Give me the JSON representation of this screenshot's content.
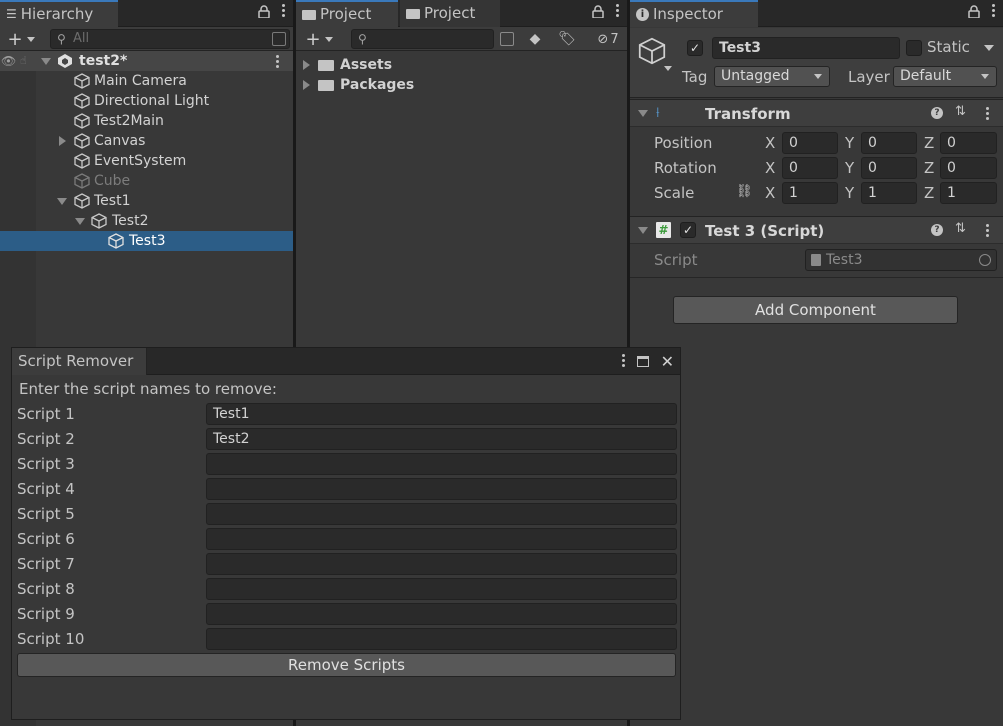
{
  "hierarchy": {
    "tab_label": "Hierarchy",
    "search_placeholder": "All",
    "items": [
      {
        "label": "test2*"
      },
      {
        "label": "Main Camera"
      },
      {
        "label": "Directional Light"
      },
      {
        "label": "Test2Main"
      },
      {
        "label": "Canvas"
      },
      {
        "label": "EventSystem"
      },
      {
        "label": "Cube"
      },
      {
        "label": "Test1"
      },
      {
        "label": "Test2"
      },
      {
        "label": "Test3"
      }
    ]
  },
  "project": {
    "tabs": [
      "Project",
      "Project"
    ],
    "hidden_count": "7",
    "folders": [
      "Assets",
      "Packages"
    ]
  },
  "inspector": {
    "tab_label": "Inspector",
    "object_name": "Test3",
    "static_label": "Static",
    "tag_label": "Tag",
    "tag_value": "Untagged",
    "layer_label": "Layer",
    "layer_value": "Default",
    "transform": {
      "title": "Transform",
      "position_label": "Position",
      "rotation_label": "Rotation",
      "scale_label": "Scale",
      "x": "X",
      "y": "Y",
      "z": "Z",
      "position": [
        "0",
        "0",
        "0"
      ],
      "rotation": [
        "0",
        "0",
        "0"
      ],
      "scale": [
        "1",
        "1",
        "1"
      ]
    },
    "script_component": {
      "title": "Test 3 (Script)",
      "script_label": "Script",
      "script_value": "Test3"
    },
    "add_component": "Add Component"
  },
  "script_remover": {
    "tab_label": "Script Remover",
    "instruction": "Enter the script names to remove:",
    "fields": [
      {
        "label": "Script 1",
        "value": "Test1"
      },
      {
        "label": "Script 2",
        "value": "Test2"
      },
      {
        "label": "Script 3",
        "value": ""
      },
      {
        "label": "Script 4",
        "value": ""
      },
      {
        "label": "Script 5",
        "value": ""
      },
      {
        "label": "Script 6",
        "value": ""
      },
      {
        "label": "Script 7",
        "value": ""
      },
      {
        "label": "Script 8",
        "value": ""
      },
      {
        "label": "Script 9",
        "value": ""
      },
      {
        "label": "Script 10",
        "value": ""
      }
    ],
    "button": "Remove Scripts"
  },
  "colors": {
    "selection": "#2c5d87",
    "tab_accent": "#3a79bb",
    "panel_bg": "#383838",
    "field_bg": "#2a2a2a"
  }
}
